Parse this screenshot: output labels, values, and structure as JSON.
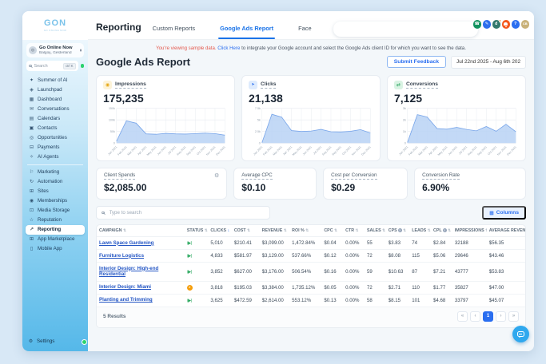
{
  "colors": {
    "accent": "#1a73e8",
    "link": "#2a6ef0",
    "notice_red": "#e4594e",
    "chart_fill": "#b9d2f4",
    "chart_stroke": "#79a6ea",
    "enabled_green": "#21a457",
    "paused_orange": "#f59e0b",
    "fab_blue": "#2fa8ee"
  },
  "sidebar": {
    "logo": {
      "text": "GON",
      "subtext": "GO ONLINE NOW"
    },
    "account": {
      "name": "Go Online Now",
      "location": "Balgoij, Gelderland"
    },
    "search": {
      "placeholder": "Search",
      "shortcut": "ctrl K"
    },
    "nav_primary": [
      {
        "label": "Summer of AI",
        "icon": "✦",
        "name": "summer-of-ai"
      },
      {
        "label": "Launchpad",
        "icon": "◈",
        "name": "launchpad"
      },
      {
        "label": "Dashboard",
        "icon": "▦",
        "name": "dashboard"
      },
      {
        "label": "Conversations",
        "icon": "✉",
        "name": "conversations"
      },
      {
        "label": "Calendars",
        "icon": "▤",
        "name": "calendars"
      },
      {
        "label": "Contacts",
        "icon": "▣",
        "name": "contacts"
      },
      {
        "label": "Opportunities",
        "icon": "◎",
        "name": "opportunities"
      },
      {
        "label": "Payments",
        "icon": "⊟",
        "name": "payments"
      },
      {
        "label": "AI Agents",
        "icon": "✧",
        "name": "ai-agents"
      }
    ],
    "nav_secondary": [
      {
        "label": "Marketing",
        "icon": "⚐",
        "name": "marketing"
      },
      {
        "label": "Automation",
        "icon": "↻",
        "name": "automation"
      },
      {
        "label": "Sites",
        "icon": "⊞",
        "name": "sites"
      },
      {
        "label": "Memberships",
        "icon": "◉",
        "name": "memberships"
      },
      {
        "label": "Media Storage",
        "icon": "⊡",
        "name": "media-storage"
      },
      {
        "label": "Reputation",
        "icon": "☆",
        "name": "reputation"
      },
      {
        "label": "Reporting",
        "icon": "↗",
        "name": "reporting",
        "active": true
      },
      {
        "label": "App Marketplace",
        "icon": "⊞",
        "name": "app-marketplace"
      },
      {
        "label": "Mobile App",
        "icon": "▯",
        "name": "mobile-app"
      }
    ],
    "settings_label": "Settings"
  },
  "topbar": {
    "title": "Reporting",
    "tabs": [
      {
        "label": "Custom Reports",
        "active": false
      },
      {
        "label": "Google Ads Report",
        "active": true
      },
      {
        "label": "Face",
        "active": false
      }
    ],
    "icons": [
      {
        "name": "phone",
        "bg": "#12935f",
        "glyph": "☎"
      },
      {
        "name": "compose",
        "bg": "#2f6fed",
        "glyph": "✎"
      },
      {
        "name": "d-app",
        "bg": "#33796d",
        "glyph": "d",
        "badge": true
      },
      {
        "name": "notification-bell",
        "bg": "#f4581c",
        "bell": true
      },
      {
        "name": "help",
        "bg": "#2a6ef0",
        "glyph": "?"
      },
      {
        "name": "user-avatar",
        "bg": "#c9b178",
        "glyph": "CB",
        "small": true
      }
    ]
  },
  "notice": {
    "highlight": "You're viewing sample data. ",
    "link": "Click Here",
    "rest": " to integrate your Google account and select the Google Ads client ID for which you want to see the data."
  },
  "page": {
    "title": "Google Ads Report",
    "feedback": "Submit Feedback",
    "date_range": "Jul 22nd 2025 - Aug 6th 202"
  },
  "chart_data": [
    {
      "type": "area",
      "metric": "Impressions",
      "total": "175,235",
      "icon": "eye",
      "icon_bg": "#fdf3d8",
      "icon_color": "#e6a817",
      "x": [
        "Jan 2021",
        "Feb 2021",
        "Mar 2021",
        "Apr 2021",
        "May 2021",
        "Jun 2021",
        "Jul 2021",
        "Aug 2021",
        "Sep 2021",
        "Oct 2021",
        "Nov 2021",
        "Dec 2021"
      ],
      "values": [
        8000,
        96000,
        86000,
        40000,
        38000,
        42000,
        40000,
        39000,
        41000,
        43000,
        41000,
        34000
      ],
      "ylim": [
        0,
        150000
      ],
      "yticks": [
        {
          "label": "150k",
          "value": 150000
        },
        {
          "label": "100k",
          "value": 100000
        },
        {
          "label": "50k",
          "value": 50000
        },
        {
          "label": "0",
          "value": 0
        }
      ]
    },
    {
      "type": "area",
      "metric": "Clicks",
      "total": "21,138",
      "icon": "cursor",
      "icon_bg": "#deebfd",
      "icon_color": "#2a6ef0",
      "x": [
        "Jan 2021",
        "Feb 2021",
        "Mar 2021",
        "Apr 2021",
        "May 2021",
        "Jun 2021",
        "Jul 2021",
        "Aug 2021",
        "Sep 2021",
        "Oct 2021",
        "Nov 2021",
        "Dec 2021"
      ],
      "values": [
        100,
        6200,
        5600,
        2700,
        2500,
        2600,
        2950,
        2450,
        2400,
        2550,
        2900,
        2200
      ],
      "ylim": [
        0,
        7500
      ],
      "yticks": [
        {
          "label": "7.5k",
          "value": 7500
        },
        {
          "label": "5k",
          "value": 5000
        },
        {
          "label": "2.5k",
          "value": 2500
        },
        {
          "label": "0",
          "value": 0
        }
      ]
    },
    {
      "type": "area",
      "metric": "Conversions",
      "total": "7,125",
      "icon": "conversion",
      "icon_bg": "#d9f3e3",
      "icon_color": "#1e9e55",
      "x": [
        "Jan 2021",
        "Feb 2021",
        "Mar 2021",
        "Apr 2021",
        "May 2021",
        "Jun 2021",
        "Jul 2021",
        "Aug 2021",
        "Sep 2021",
        "Oct 2021",
        "Nov 2021",
        "Dec 2021"
      ],
      "values": [
        60,
        2450,
        2250,
        1250,
        1200,
        1350,
        1180,
        1060,
        1430,
        1020,
        1620,
        980
      ],
      "ylim": [
        0,
        3000
      ],
      "yticks": [
        {
          "label": "3k",
          "value": 3000
        },
        {
          "label": "2k",
          "value": 2000
        },
        {
          "label": "1k",
          "value": 1000
        },
        {
          "label": "0",
          "value": 0
        }
      ]
    }
  ],
  "stat_cards": [
    {
      "label": "Client Spends",
      "value": "$2,085.00",
      "gear": true
    },
    {
      "label": "Average CPC",
      "value": "$0.10"
    },
    {
      "label": "Cost per Conversion",
      "value": "$0.29"
    },
    {
      "label": "Conversion Rate",
      "value": "6.90%"
    }
  ],
  "table": {
    "search_placeholder": "Type to search",
    "columns_button": "Columns",
    "headers": [
      {
        "label": "CAMPAIGN",
        "sort": "both"
      },
      {
        "label": "STATUS",
        "sort": "both"
      },
      {
        "label": "CLICKS",
        "sort": "desc"
      },
      {
        "label": "COST",
        "sort": "both"
      },
      {
        "label": "REVENUE",
        "sort": "both"
      },
      {
        "label": "ROI %",
        "sort": "both"
      },
      {
        "label": "CPC",
        "sort": "both"
      },
      {
        "label": "CTR",
        "sort": "both"
      },
      {
        "label": "SALES",
        "sort": "both"
      },
      {
        "label": "CPS",
        "sort": "both",
        "info": true
      },
      {
        "label": "LEADS",
        "sort": "both"
      },
      {
        "label": "CPL",
        "sort": "both",
        "info": true
      },
      {
        "label": "IMPRESSIONS",
        "sort": "both"
      },
      {
        "label": "AVERAGE REVENUE",
        "sort": "both"
      }
    ],
    "rows": [
      {
        "campaign": "Lawn Space Gardening",
        "status": "enabled",
        "clicks": "5,010",
        "cost": "$210.41",
        "revenue": "$3,099.00",
        "roi": "1,472.84%",
        "cpc": "$0.04",
        "ctr": "0.00%",
        "sales": "55",
        "cps": "$3.83",
        "leads": "74",
        "cpl": "$2.84",
        "impressions": "32188",
        "avg_revenue": "$56.35"
      },
      {
        "campaign": "Furniture Logistics",
        "status": "enabled",
        "clicks": "4,833",
        "cost": "$581.97",
        "revenue": "$3,129.00",
        "roi": "537.66%",
        "cpc": "$0.12",
        "ctr": "0.00%",
        "sales": "72",
        "cps": "$8.08",
        "leads": "115",
        "cpl": "$5.06",
        "impressions": "29646",
        "avg_revenue": "$43.46"
      },
      {
        "campaign": "Interior Design: High-end Residential",
        "status": "enabled",
        "clicks": "3,852",
        "cost": "$627.00",
        "revenue": "$3,176.00",
        "roi": "506.54%",
        "cpc": "$0.16",
        "ctr": "0.00%",
        "sales": "59",
        "cps": "$10.63",
        "leads": "87",
        "cpl": "$7.21",
        "impressions": "43777",
        "avg_revenue": "$53.83"
      },
      {
        "campaign": "Interior Design: Miami",
        "status": "paused",
        "clicks": "3,818",
        "cost": "$195.03",
        "revenue": "$3,384.00",
        "roi": "1,735.12%",
        "cpc": "$0.05",
        "ctr": "0.00%",
        "sales": "72",
        "cps": "$2.71",
        "leads": "110",
        "cpl": "$1.77",
        "impressions": "35827",
        "avg_revenue": "$47.00"
      },
      {
        "campaign": "Planting and Trimming",
        "status": "enabled",
        "clicks": "3,625",
        "cost": "$472.59",
        "revenue": "$2,614.00",
        "roi": "553.12%",
        "cpc": "$0.13",
        "ctr": "0.00%",
        "sales": "58",
        "cps": "$8.15",
        "leads": "101",
        "cpl": "$4.68",
        "impressions": "33797",
        "avg_revenue": "$45.07"
      }
    ],
    "results": "5 Results",
    "pagination": [
      "«",
      "‹",
      "1",
      "›",
      "»"
    ],
    "active_page": "1"
  }
}
